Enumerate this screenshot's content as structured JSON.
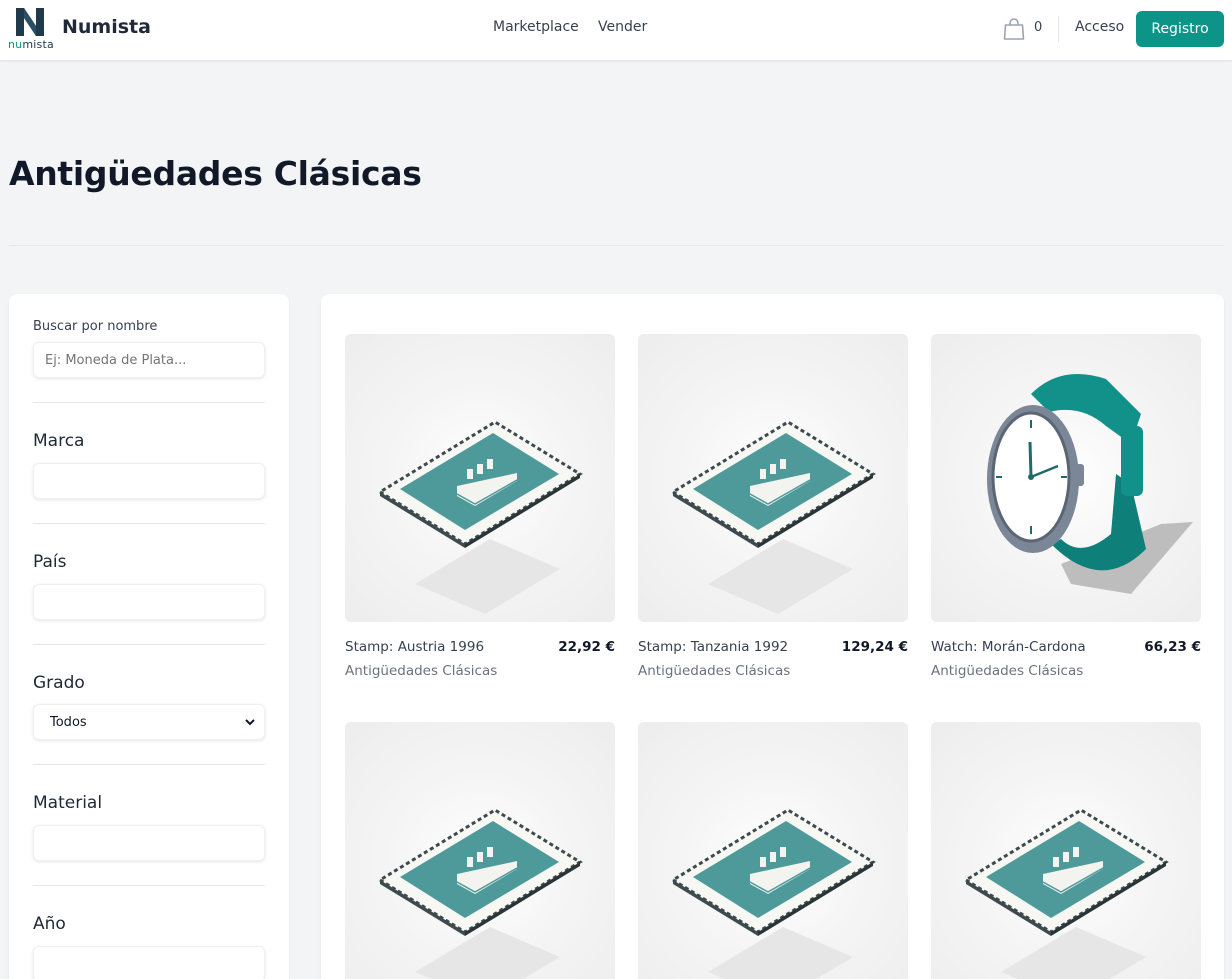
{
  "header": {
    "logo_text_a": "nu",
    "logo_text_b": "mista",
    "brand": "Numista",
    "nav": [
      "Marketplace",
      "Vender"
    ],
    "cart_count": "0",
    "login": "Acceso",
    "register": "Registro"
  },
  "page": {
    "title": "Antigüedades Clásicas"
  },
  "filters": {
    "search_label": "Buscar por nombre",
    "search_placeholder": "Ej: Moneda de Plata...",
    "brand_label": "Marca",
    "country_label": "País",
    "grade_label": "Grado",
    "grade_value": "Todos",
    "material_label": "Material",
    "year_label": "Año"
  },
  "products": [
    {
      "name": "Stamp: Austria 1996",
      "price": "22,92 €",
      "category": "Antigüedades Clásicas",
      "image": "stamp-ship"
    },
    {
      "name": "Stamp: Tanzania 1992",
      "price": "129,24 €",
      "category": "Antigüedades Clásicas",
      "image": "stamp-ship"
    },
    {
      "name": "Watch: Morán-Cardona",
      "price": "66,23 €",
      "category": "Antigüedades Clásicas",
      "image": "wristwatch"
    },
    {
      "name": "",
      "price": "",
      "category": "",
      "image": "stamp-ship"
    },
    {
      "name": "",
      "price": "",
      "category": "",
      "image": "stamp-ship"
    },
    {
      "name": "",
      "price": "",
      "category": "",
      "image": "stamp-ship"
    }
  ],
  "colors": {
    "accent": "#0d9488",
    "stamp_teal": "#4e9a9b",
    "watch_strap": "#11918a",
    "watch_case": "#7b8797"
  }
}
